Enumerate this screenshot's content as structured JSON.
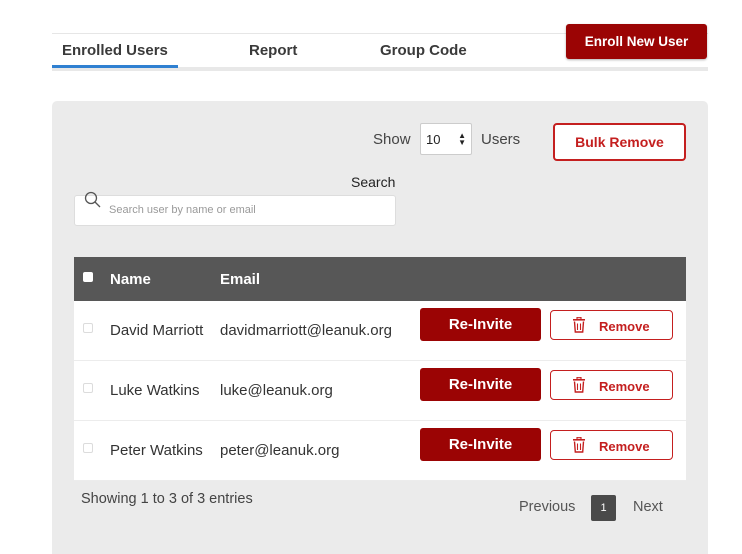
{
  "tabs": [
    {
      "label": "Enrolled Users"
    },
    {
      "label": "Report"
    },
    {
      "label": "Group Code"
    }
  ],
  "enroll_button": "Enroll New User",
  "controls": {
    "show_label": "Show",
    "page_size": "10",
    "users_label": "Users",
    "bulk_remove": "Bulk Remove",
    "search_label": "Search",
    "search_placeholder": "Search user by name or email"
  },
  "table": {
    "headers": {
      "name": "Name",
      "email": "Email"
    },
    "rows": [
      {
        "name": "David Marriott",
        "email": "davidmarriott@leanuk.org"
      },
      {
        "name": "Luke Watkins",
        "email": "luke@leanuk.org"
      },
      {
        "name": "Peter Watkins",
        "email": "peter@leanuk.org"
      }
    ],
    "reinvite_label": "Re-Invite",
    "remove_label": "Remove"
  },
  "footer": {
    "showing": "Showing 1 to 3 of 3 entries",
    "previous": "Previous",
    "page": "1",
    "next": "Next"
  },
  "colors": {
    "primary": "#9b0404",
    "danger": "#c41f1f",
    "header_bg": "#575757",
    "tab_active": "#2f80d1"
  }
}
